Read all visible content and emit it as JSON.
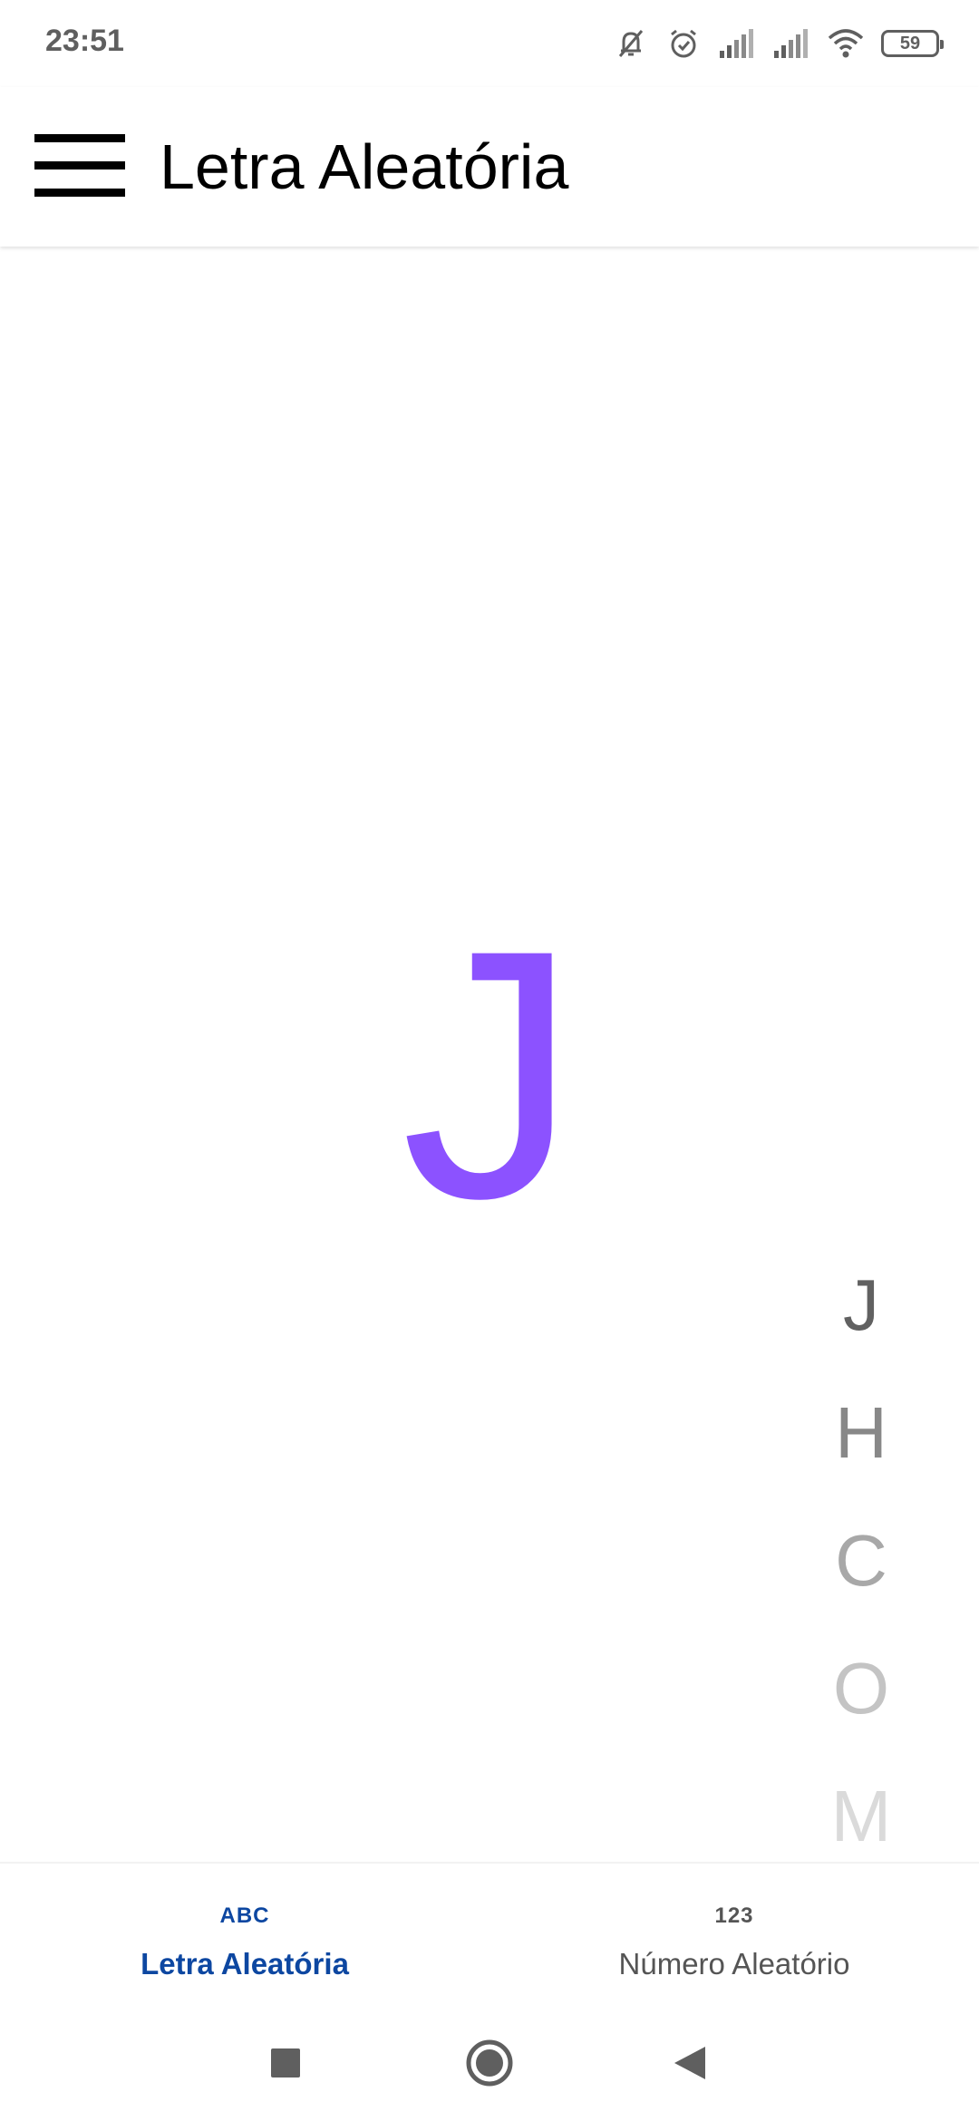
{
  "status_bar": {
    "time": "23:51",
    "battery_level": "59",
    "icons": [
      "bell-off-icon",
      "alarm-icon",
      "signal-icon",
      "signal-icon",
      "wifi-icon",
      "battery-icon"
    ]
  },
  "app_bar": {
    "title": "Letra Aleatória",
    "menu_icon": "menu-icon"
  },
  "main": {
    "current_letter": "J",
    "letter_color": "#8c52ff"
  },
  "history": {
    "letters": [
      "J",
      "H",
      "C",
      "O",
      "M"
    ],
    "colors": [
      "#616161",
      "#888888",
      "#a8a8a8",
      "#c4c4c4",
      "#dadada"
    ]
  },
  "bottom_nav": {
    "tabs": [
      {
        "icon_text": "ABC",
        "label": "Letra Aleatória",
        "active": true
      },
      {
        "icon_text": "123",
        "label": "Número Aleatório",
        "active": false
      }
    ],
    "active_color": "#0d47a1",
    "inactive_color": "#555555"
  },
  "system_nav": {
    "buttons": [
      "recent-apps-icon",
      "home-icon",
      "back-icon"
    ]
  }
}
